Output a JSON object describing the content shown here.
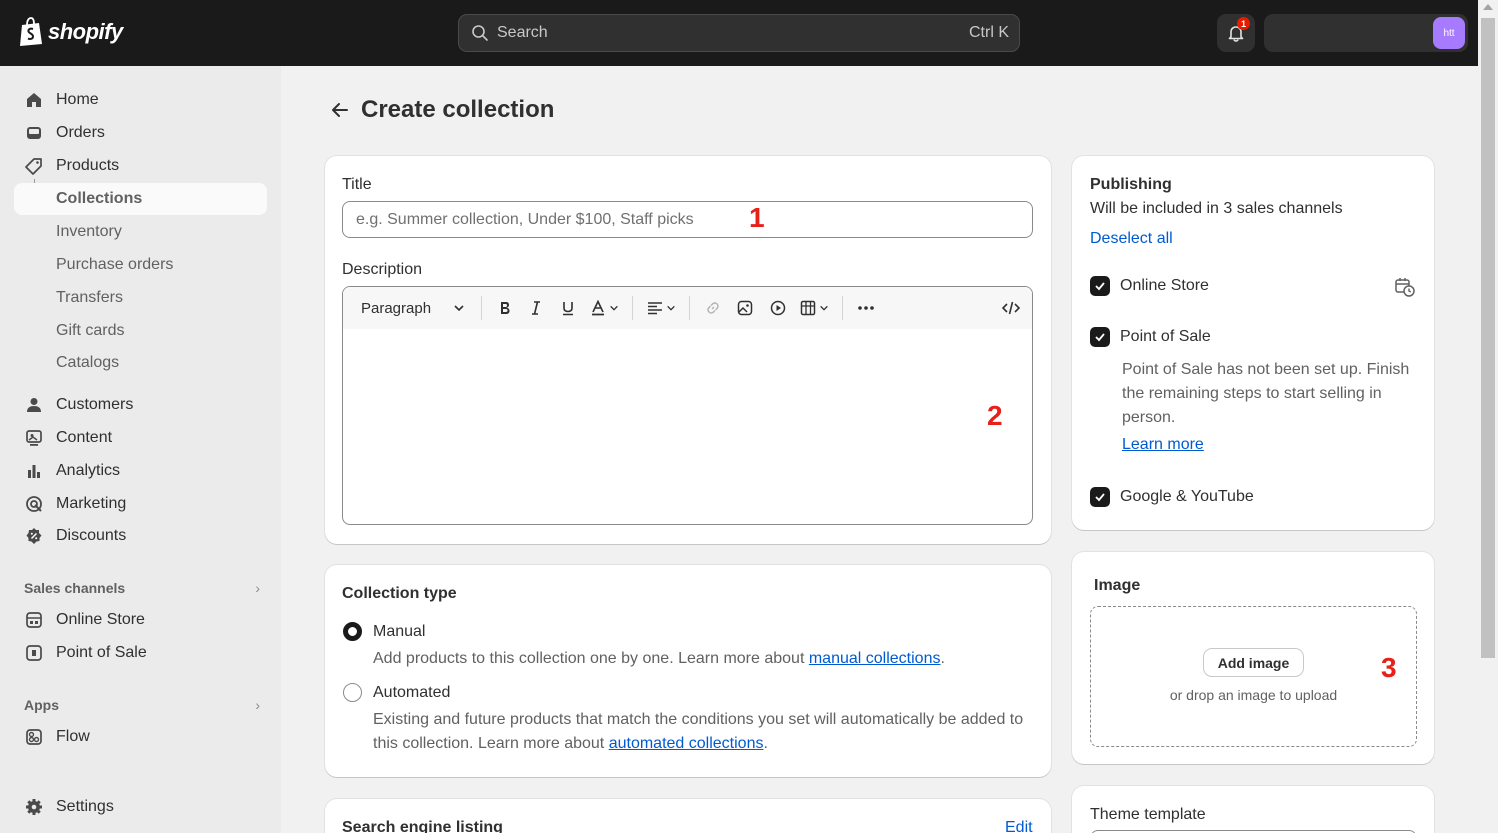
{
  "topbar": {
    "brand": "shopify",
    "search_label": "Search",
    "search_shortcut": "Ctrl K",
    "notification_count": "1",
    "avatar_initials": "htt"
  },
  "sidebar": {
    "main_items": [
      {
        "label": "Home",
        "icon": "home-icon"
      },
      {
        "label": "Orders",
        "icon": "orders-icon"
      },
      {
        "label": "Products",
        "icon": "tag-icon"
      }
    ],
    "product_sub_items": [
      {
        "label": "Collections",
        "active": true
      },
      {
        "label": "Inventory"
      },
      {
        "label": "Purchase orders"
      },
      {
        "label": "Transfers"
      },
      {
        "label": "Gift cards"
      },
      {
        "label": "Catalogs"
      }
    ],
    "other_items": [
      {
        "label": "Customers",
        "icon": "person-icon"
      },
      {
        "label": "Content",
        "icon": "content-icon"
      },
      {
        "label": "Analytics",
        "icon": "bar-chart-icon"
      },
      {
        "label": "Marketing",
        "icon": "target-icon"
      },
      {
        "label": "Discounts",
        "icon": "discount-icon"
      }
    ],
    "sales_channels_title": "Sales channels",
    "sales_channels": [
      {
        "label": "Online Store",
        "icon": "store-icon"
      },
      {
        "label": "Point of Sale",
        "icon": "pos-icon"
      }
    ],
    "apps_title": "Apps",
    "apps": [
      {
        "label": "Flow",
        "icon": "flow-icon"
      }
    ],
    "settings_label": "Settings"
  },
  "main": {
    "page_title": "Create collection",
    "title_card": {
      "title_label": "Title",
      "title_placeholder": "e.g. Summer collection, Under $100, Staff picks",
      "description_label": "Description",
      "toolbar_format": "Paragraph",
      "annotation_1": "1",
      "annotation_2": "2"
    },
    "collection_type": {
      "heading": "Collection type",
      "selected": "Manual",
      "manual_label": "Manual",
      "manual_help": "Add products to this collection one by one. Learn more about",
      "manual_link": "manual collections",
      "automated_label": "Automated",
      "automated_help": "Existing and future products that match the conditions you set will automatically be added to this collection. Learn more about",
      "automated_link": "automated collections"
    },
    "seo": {
      "heading": "Search engine listing",
      "edit_label": "Edit"
    },
    "publishing": {
      "heading": "Publishing",
      "subtitle": "Will be included in 3 sales channels",
      "deselect_label": "Deselect all",
      "channels": [
        {
          "label": "Online Store",
          "checked": true
        },
        {
          "label": "Point of Sale",
          "checked": true
        },
        {
          "label": "Google & YouTube",
          "checked": true
        }
      ],
      "pos_note": "Point of Sale has not been set up. Finish the remaining steps to start selling in person.",
      "learn_more": "Learn more"
    },
    "image": {
      "heading": "Image",
      "add_button": "Add image",
      "drop_hint": "or drop an image to upload",
      "annotation_3": "3"
    },
    "theme_template": {
      "heading": "Theme template"
    }
  }
}
